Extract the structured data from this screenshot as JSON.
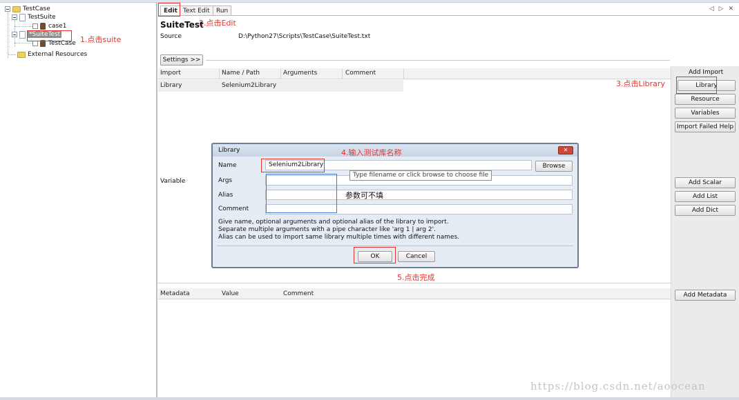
{
  "tree": {
    "items": [
      {
        "label": "TestCase"
      },
      {
        "label": "TestSuite"
      },
      {
        "label": "case1"
      },
      {
        "label": "*SuiteTest"
      },
      {
        "label": "TestCase"
      },
      {
        "label": "External Resources"
      }
    ]
  },
  "tabs": [
    {
      "label": "Edit"
    },
    {
      "label": "Text Edit"
    },
    {
      "label": "Run"
    }
  ],
  "tab_arrows": "◁ ▷ ✕",
  "editor": {
    "title": "SuiteTest",
    "source_label": "Source",
    "source_path": "D:\\Python27\\Scripts\\TestCase\\SuiteTest.txt",
    "settings_button": "Settings >>",
    "import_table": {
      "headers": [
        "Import",
        "Name / Path",
        "Arguments",
        "Comment"
      ],
      "rows": [
        [
          "Library",
          "Selenium2Library",
          "",
          ""
        ]
      ]
    },
    "variable_label": "Variable",
    "metadata_table": {
      "headers": [
        "Metadata",
        "Value",
        "Comment"
      ]
    }
  },
  "side_buttons": {
    "add_import_label": "Add Import",
    "library": "Library",
    "resource": "Resource",
    "variables": "Variables",
    "import_failed_help": "Import Failed Help",
    "add_scalar": "Add Scalar",
    "add_list": "Add List",
    "add_dict": "Add Dict",
    "add_metadata": "Add Metadata"
  },
  "dialog": {
    "title": "Library",
    "close_glyph": "✕",
    "name_label": "Name",
    "name_value": "Selenium2Library",
    "browse_button": "Browse",
    "tooltip": "Type filename or click browse to choose file",
    "args_label": "Args",
    "alias_label": "Alias",
    "comment_label": "Comment",
    "help_lines": [
      "Give name, optional arguments and optional alias of the library to import.",
      "Separate multiple arguments with a pipe character like 'arg 1 | arg 2'.",
      "Alias can be used to import same library multiple times with different names."
    ],
    "ok_button": "OK",
    "cancel_button": "Cancel"
  },
  "annotations": {
    "step1": "1.点击suite",
    "step2": "2.点击Edit",
    "step3": "3.点击Library",
    "step4": "4.输入测试库名称",
    "params_note": "参数可不填",
    "step5": "5.点击完成"
  },
  "watermark": "https://blog.csdn.net/aoocean",
  "colors": {
    "annotation_red": "#e5332a",
    "dialog_border": "#6a7d96",
    "button_panel": "#ebebeb"
  }
}
